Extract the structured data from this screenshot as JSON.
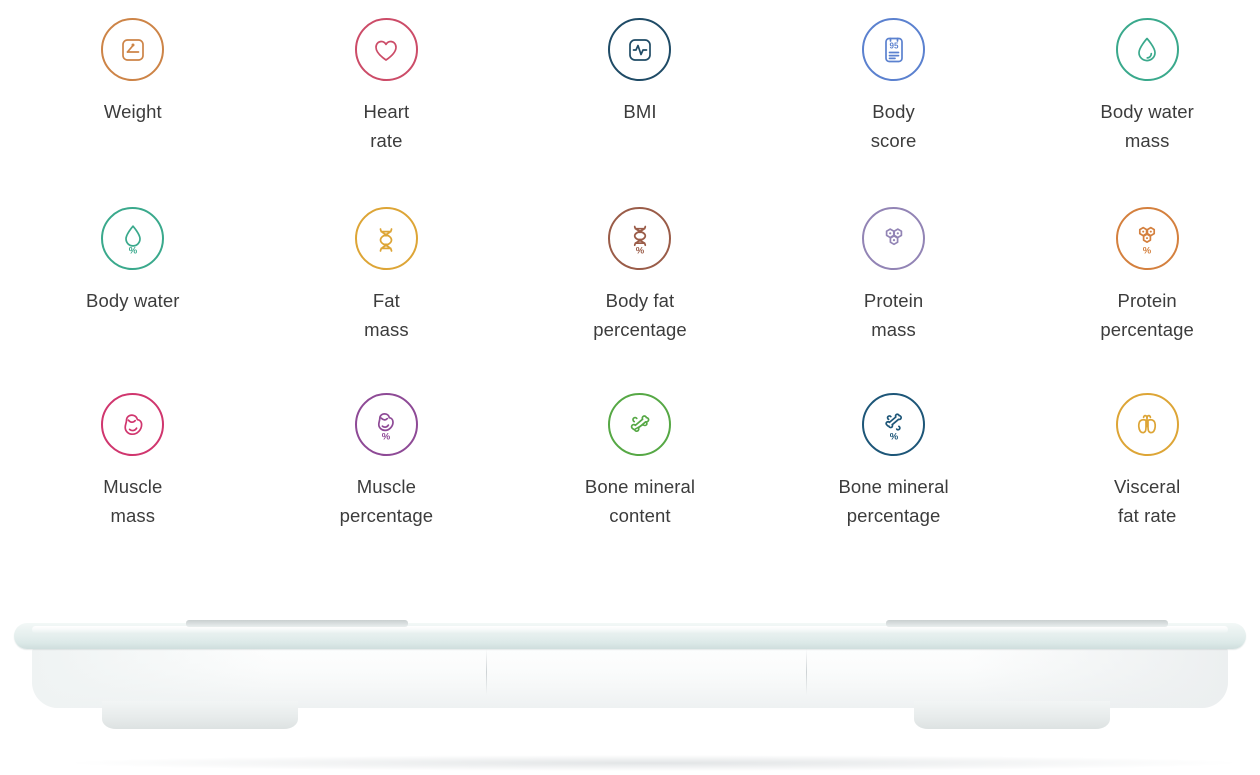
{
  "page": {
    "background_color": "#ffffff",
    "label_color": "#3c3c3c"
  },
  "metrics": {
    "rows": [
      [
        {
          "id": "weight",
          "label": "Weight",
          "icon": "scale-icon",
          "color": "#cd8447",
          "has_percent": false
        },
        {
          "id": "heart-rate",
          "label": "Heart\nrate",
          "icon": "heart-icon",
          "color": "#cc4c68",
          "has_percent": false
        },
        {
          "id": "bmi",
          "label": "BMI",
          "icon": "bmi-pulse-icon",
          "color": "#1f4b66",
          "has_percent": false
        },
        {
          "id": "body-score",
          "label": "Body\nscore",
          "icon": "score-report-icon",
          "color": "#5b81cf",
          "has_percent": false,
          "badge": "95"
        },
        {
          "id": "body-water-mass",
          "label": "Body water\nmass",
          "icon": "water-drop-icon",
          "color": "#3aa98c",
          "has_percent": false
        }
      ],
      [
        {
          "id": "body-water",
          "label": "Body water",
          "icon": "water-drop-percent-icon",
          "color": "#3aa98c",
          "has_percent": true
        },
        {
          "id": "fat-mass",
          "label": "Fat\nmass",
          "icon": "dna-icon",
          "color": "#dda536",
          "has_percent": false
        },
        {
          "id": "body-fat-percentage",
          "label": "Body fat\npercentage",
          "icon": "dna-percent-icon",
          "color": "#9a5c48",
          "has_percent": true
        },
        {
          "id": "protein-mass",
          "label": "Protein\nmass",
          "icon": "molecule-icon",
          "color": "#9284b5",
          "has_percent": false
        },
        {
          "id": "protein-percentage",
          "label": "Protein\npercentage",
          "icon": "molecule-percent-icon",
          "color": "#d4803e",
          "has_percent": true
        }
      ],
      [
        {
          "id": "muscle-mass",
          "label": "Muscle\nmass",
          "icon": "muscle-arm-icon",
          "color": "#d0366e",
          "has_percent": false
        },
        {
          "id": "muscle-percentage",
          "label": "Muscle\npercentage",
          "icon": "muscle-arm-percent-icon",
          "color": "#8e4a96",
          "has_percent": true
        },
        {
          "id": "bone-mineral-content",
          "label": "Bone mineral\ncontent",
          "icon": "bones-icon",
          "color": "#56a845",
          "has_percent": false
        },
        {
          "id": "bone-mineral-percentage",
          "label": "Bone mineral\npercentage",
          "icon": "bones-percent-icon",
          "color": "#1d5678",
          "has_percent": true
        },
        {
          "id": "visceral-fat-rate",
          "label": "Visceral\nfat rate",
          "icon": "organs-lungs-icon",
          "color": "#dda536",
          "has_percent": false
        }
      ]
    ]
  },
  "product": {
    "name": "smart-body-composition-scale",
    "description": "White smart body composition scale, side view with tempered glass top plate"
  }
}
